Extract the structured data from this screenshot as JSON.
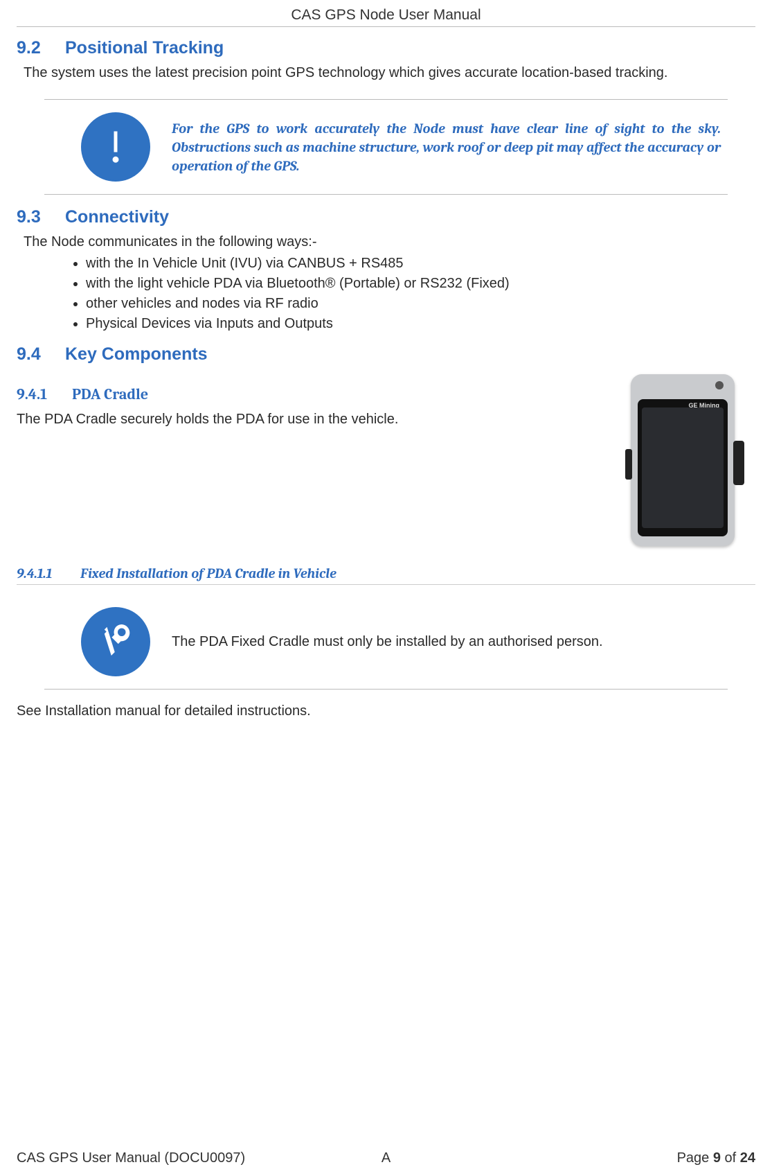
{
  "header": {
    "title": "CAS GPS Node User Manual"
  },
  "sections": {
    "s92": {
      "num": "9.2",
      "title": "Positional Tracking",
      "body": "The system uses the latest precision point GPS technology which gives accurate location-based tracking."
    },
    "s92_callout_text": "For the GPS to work accurately the Node must have clear line of sight to the sky. Obstructions such as machine structure, work roof or deep pit may affect the accuracy or operation of the GPS.",
    "s93": {
      "num": "9.3",
      "title": "Connectivity",
      "intro": "The Node communicates in the following ways:-",
      "items": [
        "with the In Vehicle Unit (IVU) via CANBUS + RS485",
        "with the light vehicle PDA via Bluetooth® (Portable) or RS232 (Fixed)",
        "other vehicles and nodes via RF radio",
        "Physical Devices via Inputs and Outputs"
      ]
    },
    "s94": {
      "num": "9.4",
      "title": "Key Components"
    },
    "s941": {
      "num": "9.4.1",
      "title": "PDA Cradle",
      "body": "The PDA Cradle securely holds the PDA for use in the vehicle.",
      "device_brand": "GE Mining"
    },
    "s9411": {
      "num": "9.4.1.1",
      "title": "Fixed Installation of PDA Cradle in Vehicle",
      "callout": "The PDA Fixed Cradle must only be installed by an authorised person.",
      "after": "See Installation manual for detailed instructions."
    }
  },
  "footer": {
    "left": "CAS GPS User Manual (DOCU0097)",
    "center": "A",
    "page_label": "Page ",
    "page_current": "9",
    "page_sep": " of ",
    "page_total": "24"
  }
}
